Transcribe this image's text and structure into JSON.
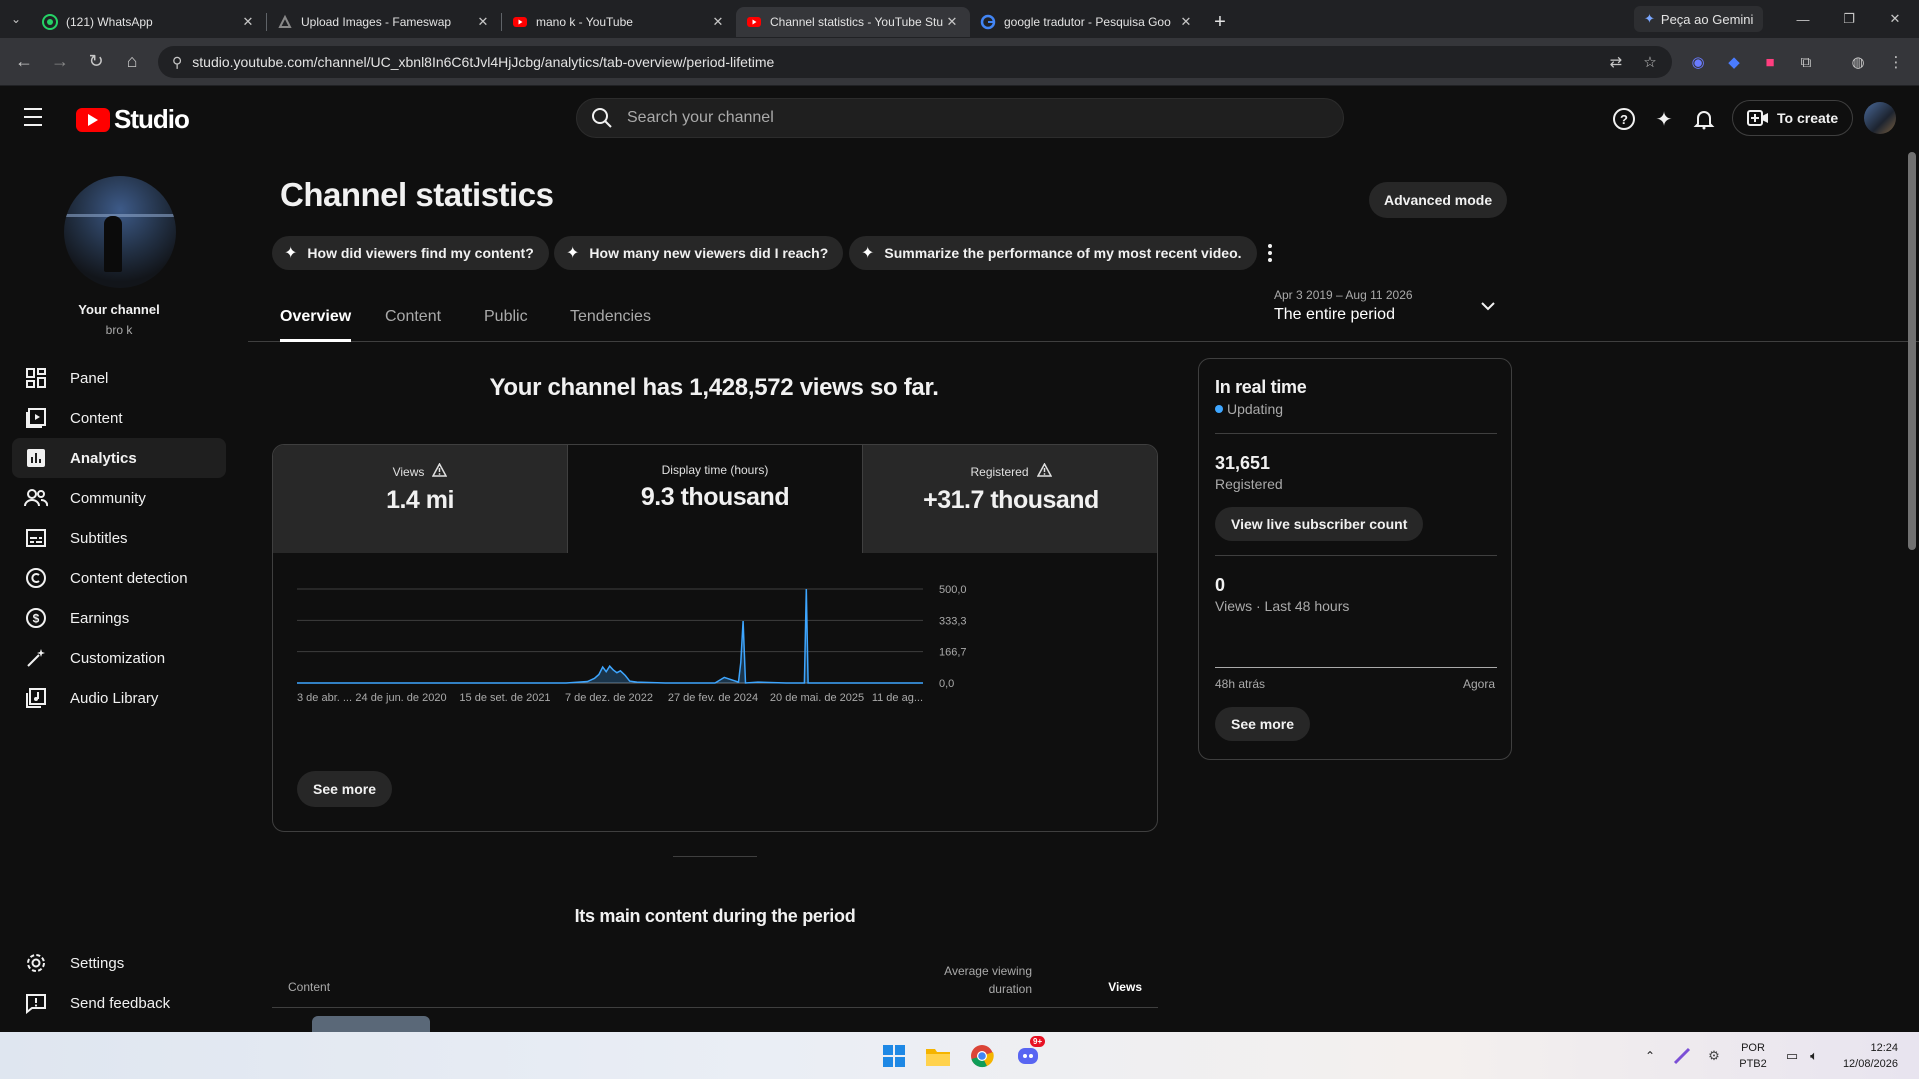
{
  "browser": {
    "tabs": [
      {
        "title": "(121) WhatsApp",
        "icon": "whatsapp-icon",
        "active": false
      },
      {
        "title": "Upload Images - Fameswap",
        "icon": "fameswap-icon",
        "active": false
      },
      {
        "title": "mano k - YouTube",
        "icon": "youtube-icon",
        "active": false
      },
      {
        "title": "Channel statistics - YouTube Stu",
        "icon": "youtube-icon",
        "active": true
      },
      {
        "title": "google tradutor - Pesquisa Goo",
        "icon": "google-icon",
        "active": false
      }
    ],
    "gemini_button": "Peça ao Gemini",
    "url": "studio.youtube.com/channel/UC_xbnl8In6C6tJvl4HjJcbg/analytics/tab-overview/period-lifetime"
  },
  "header": {
    "logo_text": "Studio",
    "search_placeholder": "Search your channel",
    "create_label": "To create"
  },
  "sidebar": {
    "channel_label": "Your channel",
    "channel_handle": "bro k",
    "items": [
      {
        "label": "Panel",
        "icon": "dashboard-icon"
      },
      {
        "label": "Content",
        "icon": "content-icon"
      },
      {
        "label": "Analytics",
        "icon": "analytics-icon",
        "active": true
      },
      {
        "label": "Community",
        "icon": "community-icon"
      },
      {
        "label": "Subtitles",
        "icon": "subtitles-icon"
      },
      {
        "label": "Content detection",
        "icon": "copyright-icon"
      },
      {
        "label": "Earnings",
        "icon": "earnings-icon"
      },
      {
        "label": "Customization",
        "icon": "customization-icon"
      },
      {
        "label": "Audio Library",
        "icon": "audio-library-icon"
      }
    ],
    "settings": "Settings",
    "feedback": "Send feedback"
  },
  "main": {
    "title": "Channel statistics",
    "advanced_mode": "Advanced mode",
    "chips": [
      "How did viewers find my content?",
      "How many new viewers did I reach?",
      "Summarize the performance of my most recent video."
    ],
    "tabs": [
      "Overview",
      "Content",
      "Public",
      "Tendencies"
    ],
    "period_range": "Apr 3 2019 – Aug 11 2026",
    "period_label": "The entire period",
    "headline": "Your channel has 1,428,572 views so far.",
    "metrics": [
      {
        "label": "Views",
        "value": "1.4 mi",
        "warning": true
      },
      {
        "label": "Display time (hours)",
        "value": "9.3 thousand",
        "warning": false
      },
      {
        "label": "Registered",
        "value": "+31.7 thousand",
        "warning": true
      }
    ],
    "see_more": "See more",
    "main_content_title": "Its main content during the period",
    "table_headers": {
      "content": "Content",
      "avg_duration": "Average viewing duration",
      "views": "Views"
    }
  },
  "realtime": {
    "title": "In real time",
    "status": "Updating",
    "subscribers": "31,651",
    "subscribers_label": "Registered",
    "live_button": "View live subscriber count",
    "views": "0",
    "views_label": "Views · Last 48 hours",
    "axis_left": "48h atrás",
    "axis_right": "Agora",
    "see_more": "See more"
  },
  "taskbar": {
    "lang_top": "POR",
    "lang_bottom": "PTB2",
    "time": "12:24",
    "date": "12/08/2026",
    "discord_badge": "9+"
  },
  "chart_data": {
    "type": "area",
    "ylim": [
      0,
      500
    ],
    "y_ticks": [
      "500,0",
      "333,3",
      "166,7",
      "0,0"
    ],
    "x_tick_labels": [
      "3 de abr. ...",
      "24 de jun. de 2020",
      "15 de set. de 2021",
      "7 de dez. de 2022",
      "27 de fev. de 2024",
      "20 de mai. de 2025",
      "11 de ag..."
    ],
    "series": [
      {
        "x": [
          "2019-04-03",
          "2022-06-01",
          "2022-09-01",
          "2022-10-01",
          "2022-10-20",
          "2022-11-05",
          "2022-11-20",
          "2022-12-05",
          "2022-12-20",
          "2023-01-05",
          "2023-01-20",
          "2023-02-10",
          "2023-03-01",
          "2023-04-01",
          "2023-08-01",
          "2024-03-01",
          "2024-04-10",
          "2024-06-10",
          "2024-06-20",
          "2024-06-30",
          "2024-07-10",
          "2024-09-01",
          "2025-01-01",
          "2025-03-20",
          "2025-03-28",
          "2025-04-05",
          "2025-05-01",
          "2026-08-11"
        ],
        "y": [
          0,
          0,
          8,
          25,
          45,
          85,
          60,
          90,
          70,
          55,
          65,
          40,
          10,
          5,
          0,
          0,
          30,
          5,
          110,
          330,
          0,
          5,
          0,
          0,
          500,
          0,
          0,
          0
        ]
      }
    ]
  }
}
